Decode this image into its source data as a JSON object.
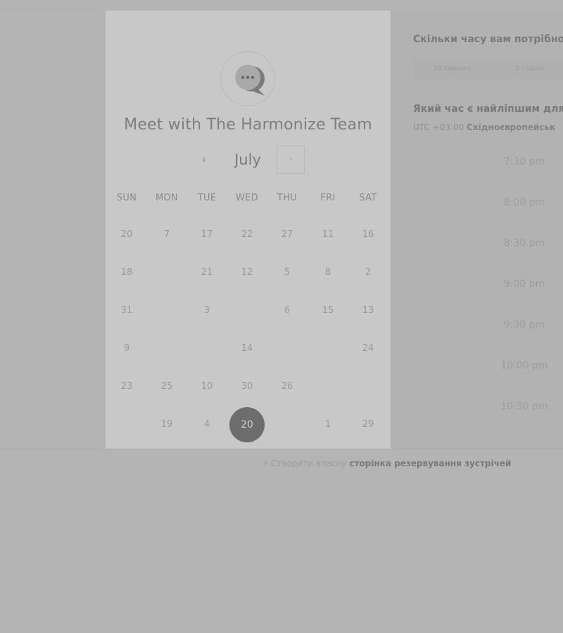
{
  "card": {
    "title": "Meet with The Harmonize Team",
    "month": "July",
    "prev_icon": "‹",
    "next_icon": "›",
    "weekdays": [
      "SUN",
      "MON",
      "TUE",
      "WED",
      "THU",
      "FRI",
      "SAT"
    ],
    "rows": [
      [
        "20",
        "7",
        "17",
        "22",
        "27",
        "11",
        "16"
      ],
      [
        "18",
        "",
        "21",
        "12",
        "5",
        "8",
        "2"
      ],
      [
        "31",
        "",
        "3",
        "",
        "6",
        "15",
        "13"
      ],
      [
        "9",
        "",
        "",
        "14",
        "",
        "",
        "24"
      ],
      [
        "23",
        "25",
        "10",
        "30",
        "26",
        "",
        ""
      ],
      [
        "",
        "19",
        "4",
        "20",
        "",
        "1",
        "29"
      ]
    ],
    "selected_day": "20"
  },
  "panel": {
    "duration_question": "Скільки часу вам потрібно",
    "duration_options": [
      "30 хвилин",
      "1 годин"
    ],
    "time_question": "Який час є найліпшим для",
    "timezone_offset": "UTC +03:00",
    "timezone_name": "Східноєвропейськ",
    "slots": [
      "7:30 pm",
      "8:00 pm",
      "8:30 pm",
      "9:00 pm",
      "9:30 pm",
      "10:00 pm",
      "10:30 pm"
    ]
  },
  "footer": {
    "prefix": "Створити власну",
    "link": "сторінка резервування зустрічей"
  },
  "colors": {
    "page_bg": "#b4b4b4",
    "card_bg": "#c8c8c8",
    "selected_day_bg": "#6d6d6d"
  },
  "icons": {
    "logo": "chat-bubbles-icon",
    "prev": "chevron-left-icon",
    "next": "chevron-right-icon",
    "footer": "sparkle-icon"
  }
}
